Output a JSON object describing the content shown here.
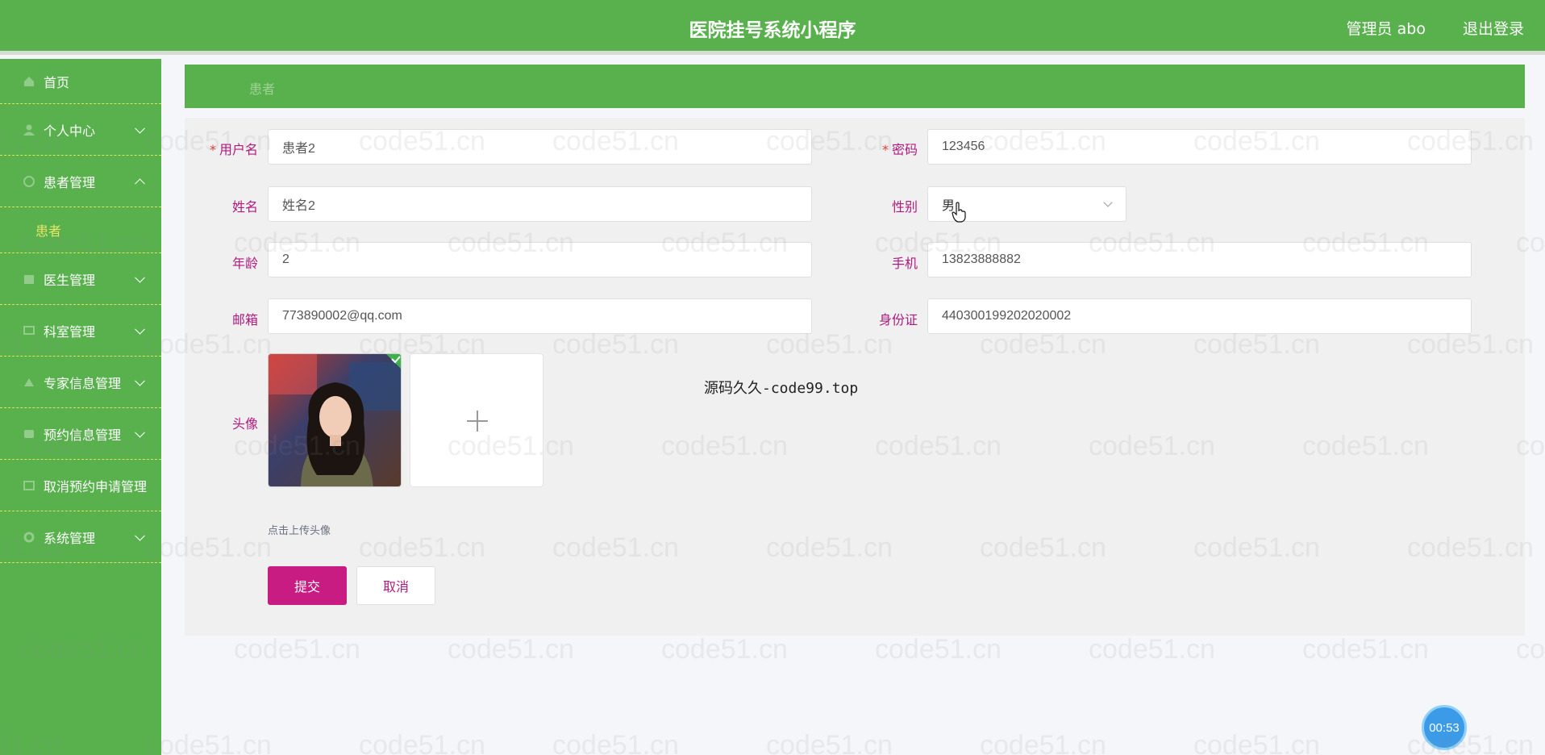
{
  "app": {
    "title": "医院挂号系统小程序"
  },
  "header": {
    "user": "管理员 abo",
    "logout": "退出登录"
  },
  "sidebar": {
    "items": [
      {
        "label": "首页",
        "icon": "home-icon"
      },
      {
        "label": "个人中心",
        "icon": "user-icon"
      },
      {
        "label": "患者管理",
        "icon": "patient-icon",
        "expanded": true,
        "children": [
          {
            "label": "患者"
          }
        ]
      },
      {
        "label": "医生管理",
        "icon": "doctor-icon"
      },
      {
        "label": "科室管理",
        "icon": "department-icon"
      },
      {
        "label": "专家信息管理",
        "icon": "expert-icon"
      },
      {
        "label": "预约信息管理",
        "icon": "appointment-icon"
      },
      {
        "label": "取消预约申请管理",
        "icon": "cancel-icon"
      },
      {
        "label": "系统管理",
        "icon": "system-icon"
      }
    ]
  },
  "breadcrumb": {
    "current": "患者"
  },
  "form": {
    "username": {
      "label": "用户名",
      "required_mark": "*",
      "value": "患者2"
    },
    "password": {
      "label": "密码",
      "required_mark": "*",
      "value": "123456"
    },
    "name": {
      "label": "姓名",
      "value": "姓名2"
    },
    "gender": {
      "label": "性别",
      "value": "男"
    },
    "age": {
      "label": "年龄",
      "value": "2"
    },
    "phone": {
      "label": "手机",
      "value": "13823888882"
    },
    "email": {
      "label": "邮箱",
      "value": "773890002@qq.com"
    },
    "idcard": {
      "label": "身份证",
      "value": "440300199202020002"
    },
    "avatar": {
      "label": "头像",
      "hint": "点击上传头像"
    },
    "overlay_text": "源码久久-code99.top",
    "submit_label": "提交",
    "cancel_label": "取消"
  },
  "watermark": "code51.cn",
  "timer": "00:53",
  "colors": {
    "primary": "#58b14d",
    "accent": "#c81c82",
    "label": "#b01a7d"
  }
}
